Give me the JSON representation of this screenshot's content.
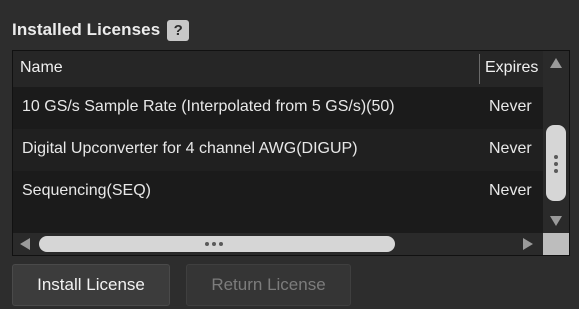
{
  "header": {
    "title": "Installed Licenses",
    "help_label": "?"
  },
  "table": {
    "columns": [
      {
        "label": "Name"
      },
      {
        "label": "Expires"
      }
    ],
    "rows": [
      {
        "name": "10 GS/s Sample Rate (Interpolated from 5 GS/s)(50)",
        "expires": "Never"
      },
      {
        "name": "Digital Upconverter for 4 channel AWG(DIGUP)",
        "expires": "Never"
      },
      {
        "name": "Sequencing(SEQ)",
        "expires": "Never"
      }
    ]
  },
  "buttons": {
    "install_label": "Install License",
    "return_label": "Return License"
  },
  "colors": {
    "background": "#2d2d2d",
    "table_background": "#1b1b1b",
    "text": "#e8e8e8",
    "disabled_text": "#7c7c7c",
    "scroll_thumb": "#d6d6d6"
  },
  "icons": {
    "help": "question-mark-icon",
    "scroll_up": "triangle-up-icon",
    "scroll_down": "triangle-down-icon",
    "scroll_left": "triangle-left-icon",
    "scroll_right": "triangle-right-icon"
  }
}
